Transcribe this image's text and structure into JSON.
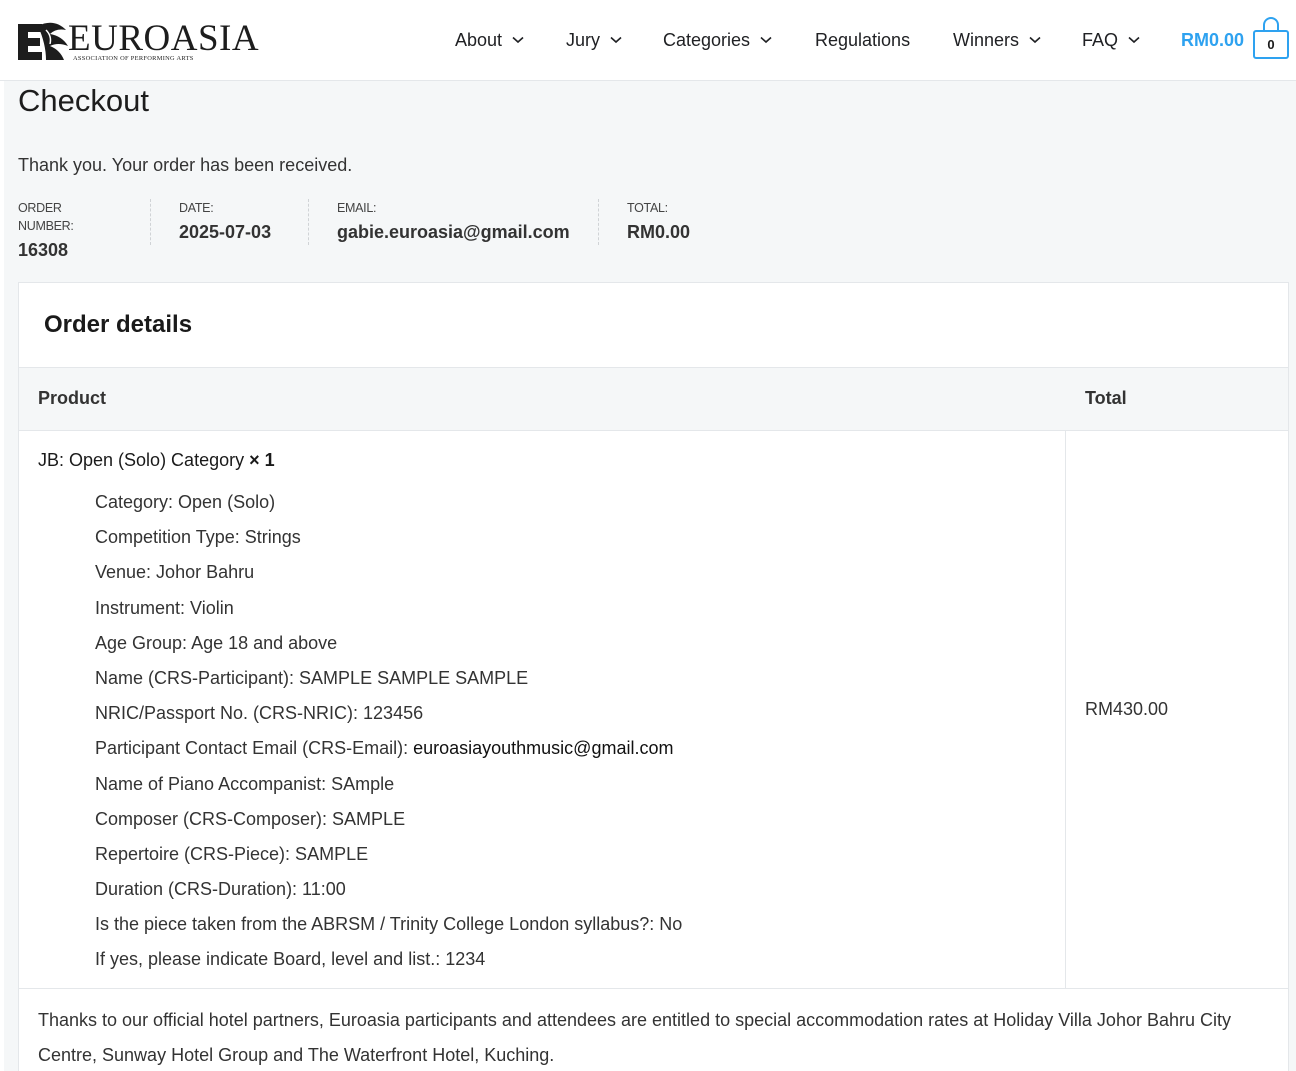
{
  "brand": {
    "name": "EUROASIA",
    "tagline": "ASSOCIATION OF PERFORMING ARTS"
  },
  "nav": {
    "items": [
      {
        "label": "About",
        "dropdown": true
      },
      {
        "label": "Jury",
        "dropdown": true
      },
      {
        "label": "Categories",
        "dropdown": true
      },
      {
        "label": "Regulations",
        "dropdown": false
      },
      {
        "label": "Winners",
        "dropdown": true
      },
      {
        "label": "FAQ",
        "dropdown": true
      }
    ],
    "cart_total": "RM0.00",
    "cart_count": "0"
  },
  "page": {
    "title": "Checkout",
    "thanks": "Thank you. Your order has been received."
  },
  "overview": {
    "order_number_label": "ORDER NUMBER:",
    "order_number": "16308",
    "date_label": "DATE:",
    "date": "2025-07-03",
    "email_label": "EMAIL:",
    "email": "gabie.euroasia@gmail.com",
    "total_label": "TOTAL:",
    "total": "RM0.00"
  },
  "order_details": {
    "heading": "Order details",
    "col_product": "Product",
    "col_total": "Total",
    "item": {
      "name": "JB: Open (Solo) Category",
      "quantity": "× 1",
      "line_total": "RM430.00",
      "meta": [
        "Category: Open (Solo)",
        "Competition Type: Strings",
        "Venue: Johor Bahru",
        "Instrument: Violin",
        "Age Group: Age 18 and above",
        "Name (CRS-Participant): SAMPLE SAMPLE SAMPLE",
        "NRIC/Passport No. (CRS-NRIC): 123456",
        "Participant Contact Email (CRS-Email): ",
        "Name of Piano Accompanist: SAmple",
        "Composer (CRS-Composer): SAMPLE",
        "Repertoire (CRS-Piece): SAMPLE",
        "Duration (CRS-Duration): 11:00",
        "Is the piece taken from the ABRSM / Trinity College London syllabus?: No",
        "If yes, please indicate Board, level and list.: 1234"
      ],
      "contact_email": "euroasiayouthmusic@gmail.com"
    },
    "note": "Thanks to our official hotel partners, Euroasia participants and attendees are entitled to special accommodation rates at Holiday Villa Johor Bahru City Centre, Sunway Hotel Group and The Waterfront Hotel, Kuching."
  },
  "colors": {
    "accent": "#2ea2f0",
    "page_bg": "#f5f7f8",
    "border": "#e4e7ea"
  }
}
